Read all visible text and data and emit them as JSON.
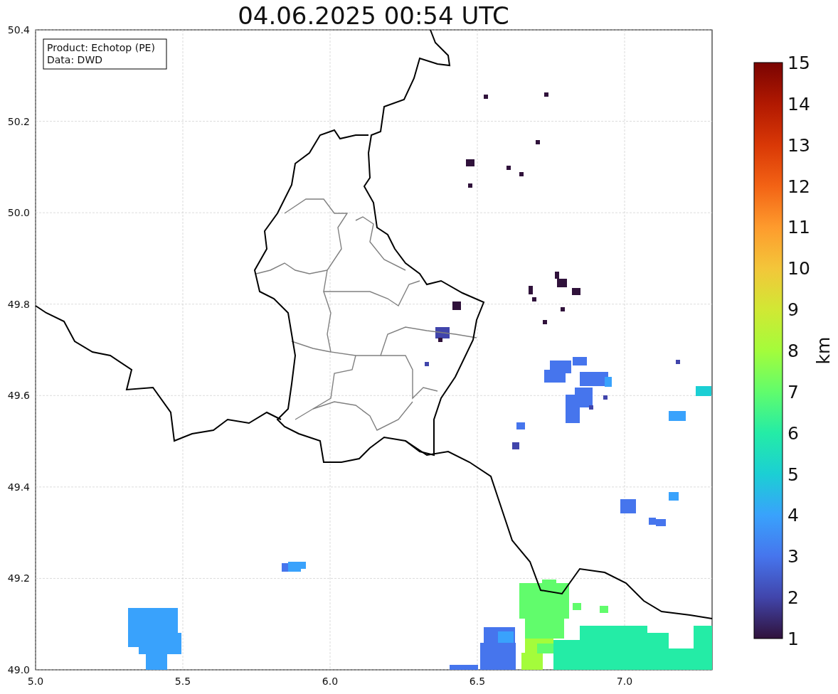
{
  "figure": {
    "title": "04.06.2025 00:54 UTC",
    "info_box": [
      "Product: Echotop (PE)",
      "Data: DWD"
    ],
    "map": {
      "x_ticks": [
        "5.0",
        "5.5",
        "6.0",
        "6.5",
        "7.0"
      ],
      "y_ticks": [
        "50.4",
        "50.2",
        "50.0",
        "49.8",
        "49.6",
        "49.4",
        "49.2",
        "49.0"
      ]
    },
    "colorbar": {
      "label": "km",
      "ticks": [
        "15",
        "14",
        "13",
        "12",
        "11",
        "10",
        "9",
        "8",
        "7",
        "6",
        "5",
        "4",
        "3",
        "2",
        "1"
      ]
    }
  }
}
